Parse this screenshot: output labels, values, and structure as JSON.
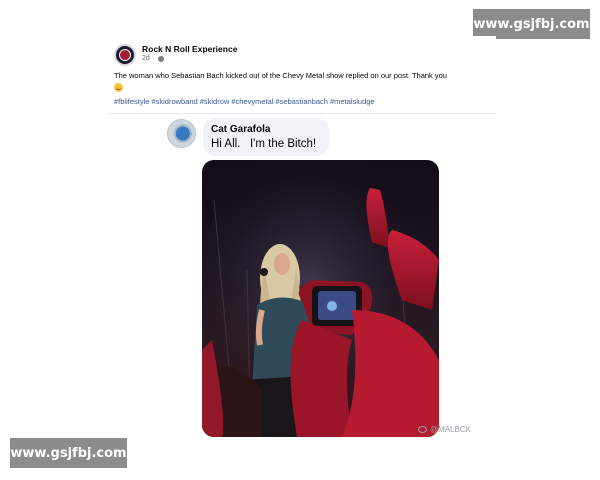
{
  "watermark": {
    "top_text": "www.gsjfbj.com",
    "bottom_text": "www.gsjfbj.com"
  },
  "post": {
    "page_name": "Rock N Roll Experience",
    "time": "2d ·",
    "text": "The woman who Sebastian Bach kicked out of the Chevy Metal show replied on our post. Thank you",
    "hashtags": [
      "#fblifestyle",
      "#skidrowband",
      "#skidrow",
      "#chevymetal",
      "#sebastianbach",
      "#metalsludge"
    ]
  },
  "comment": {
    "name": "Cat Garafola",
    "text": "Hi All.   I'm the Bitch!"
  },
  "photo": {
    "credit": "@MALBCK"
  },
  "icons": [
    "page-logo-icon",
    "globe-icon",
    "smile-emoji-icon",
    "weibo-icon"
  ],
  "colors": {
    "hashtag": "#385898",
    "bubble": "#f0f2f5",
    "text": "#050505",
    "meta": "#65676b"
  }
}
